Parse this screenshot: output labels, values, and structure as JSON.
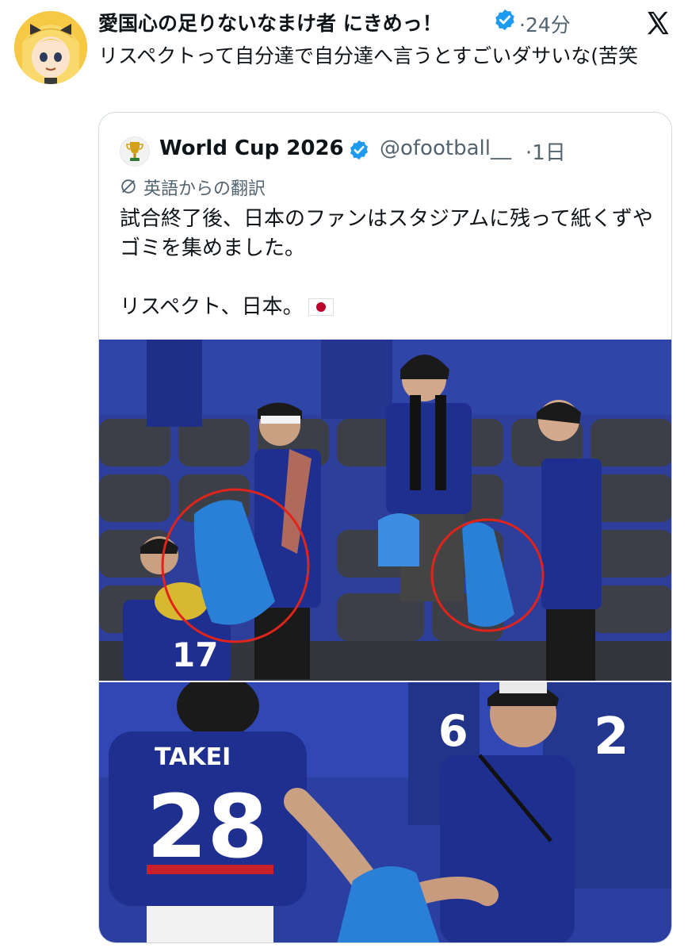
{
  "tweet": {
    "display_name": "愛国心の足りないなまけ者 にきめっ！",
    "time": "·24分",
    "text": "リスペクトって自分達で自分達へ言うとすごいダサいな(苦笑",
    "icons": [
      "avatar",
      "verified-badge-icon",
      "x-logo-icon"
    ]
  },
  "quote": {
    "name": "World Cup 2026",
    "handle": "@ofootball__",
    "time": "·1日",
    "translation_label": "英語からの翻訳",
    "text": "試合終了後、日本のファンはスタジアムに残って紙くずやゴミを集めました。\n\nリスペクト、日本。",
    "flag": "japan-flag-icon",
    "icons": [
      "trophy-avatar",
      "verified-badge-icon",
      "translate-icon"
    ]
  },
  "photos": {
    "photo1": {
      "jersey_number": "17"
    },
    "photo2": {
      "jersey_name": "TAKEI",
      "jersey_number": "28",
      "back_number_2": "2",
      "back_number_3": "6"
    }
  },
  "colors": {
    "accent_blue": "#1d9bf0",
    "secondary_text": "#536471",
    "stand_blue": "#2d3f9a",
    "jersey_blue": "#1e2f8f",
    "bag_blue": "#2a7fd6",
    "circle_red": "#e0241c"
  }
}
